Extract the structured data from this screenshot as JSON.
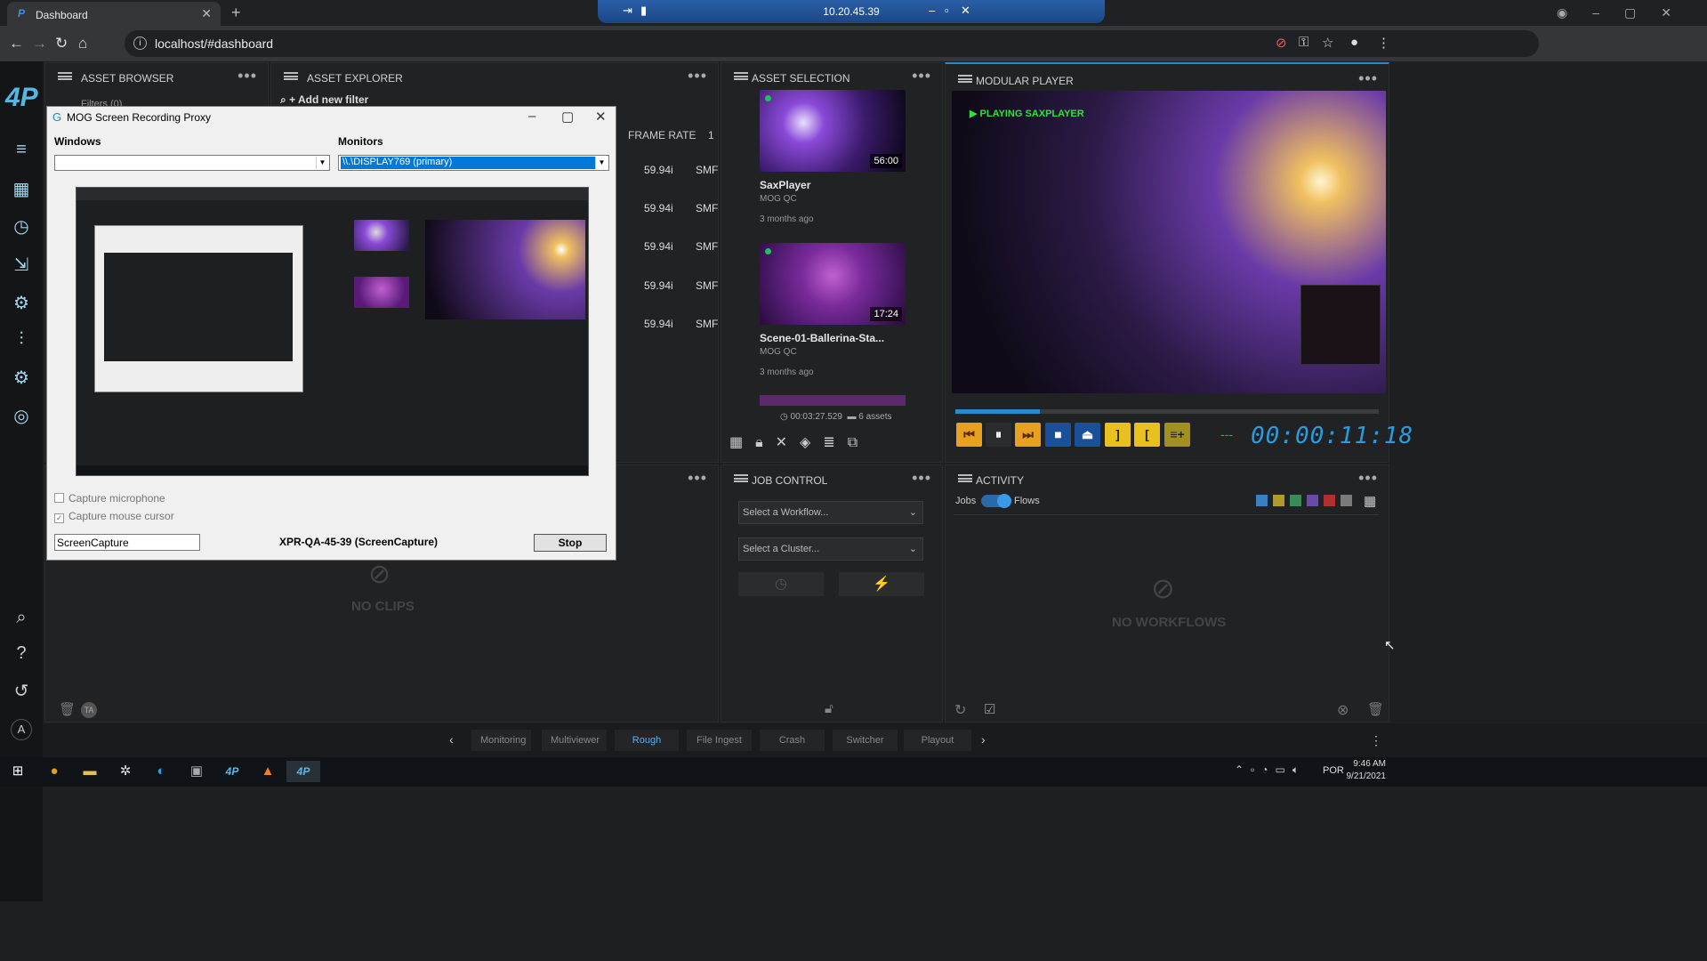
{
  "browser": {
    "tab_title": "Dashboard",
    "url": "localhost/#dashboard",
    "remote_host": "10.20.45.39"
  },
  "app": {
    "logo": "4P"
  },
  "panels": {
    "asset_browser": {
      "title": "ASSET BROWSER",
      "filters": "Filters (0)"
    },
    "asset_explorer": {
      "title": "ASSET EXPLORER",
      "add_filter": "+ Add new filter",
      "col_frame_rate": "FRAME RATE",
      "col_next": "1",
      "rows": [
        {
          "fps": "59.94i",
          "fmt": "SMF"
        },
        {
          "fps": "59.94i",
          "fmt": "SMF"
        },
        {
          "fps": "59.94i",
          "fmt": "SMF"
        },
        {
          "fps": "59.94i",
          "fmt": "SMF"
        },
        {
          "fps": "59.94i",
          "fmt": "SMF"
        }
      ]
    },
    "asset_selection": {
      "title": "ASSET SELECTION",
      "cards": [
        {
          "title": "SaxPlayer",
          "owner": "MOG QC",
          "age": "3 months ago",
          "duration": "56:00"
        },
        {
          "title": "Scene-01-Ballerina-Sta...",
          "owner": "MOG QC",
          "age": "3 months ago",
          "duration": "17:24"
        }
      ],
      "total_duration": "00:03:27.529",
      "asset_count": "6 assets"
    },
    "modular_player": {
      "title": "MODULAR PLAYER",
      "status": "PLAYING SAXPLAYER",
      "timecode": "00:00:11:18",
      "progress": 0.2,
      "tc_mode": "---"
    },
    "clips": {
      "empty": "NO CLIPS"
    },
    "job_control": {
      "title": "JOB CONTROL",
      "workflow_placeholder": "Select a Workflow...",
      "cluster_placeholder": "Select a Cluster..."
    },
    "activity": {
      "title": "ACTIVITY",
      "jobs": "Jobs",
      "flows": "Flows",
      "empty": "NO WORKFLOWS",
      "filter_colors": [
        "#3a7fc0",
        "#b09a2a",
        "#3a8a5a",
        "#6a4aa8",
        "#b03030",
        "#7a7a7a"
      ]
    }
  },
  "bottom_tabs": [
    "Monitoring",
    "Multiviewer",
    "Rough Cut",
    "File Ingest",
    "Crash Record",
    "Switcher",
    "Playout Prepar..."
  ],
  "active_tab": "Rough Cut",
  "dialog": {
    "title": "MOG Screen Recording Proxy",
    "windows_label": "Windows",
    "monitors_label": "Monitors",
    "monitor_value": "\\\\.\\DISPLAY769 (primary)",
    "capture_mic": "Capture microphone",
    "capture_cursor": "Capture mouse cursor",
    "name_value": "ScreenCapture",
    "source_text": "XPR-QA-45-39 (ScreenCapture)",
    "stop_label": "Stop"
  },
  "taskbar": {
    "language": "POR",
    "time": "9:46 AM",
    "date": "9/21/2021"
  }
}
